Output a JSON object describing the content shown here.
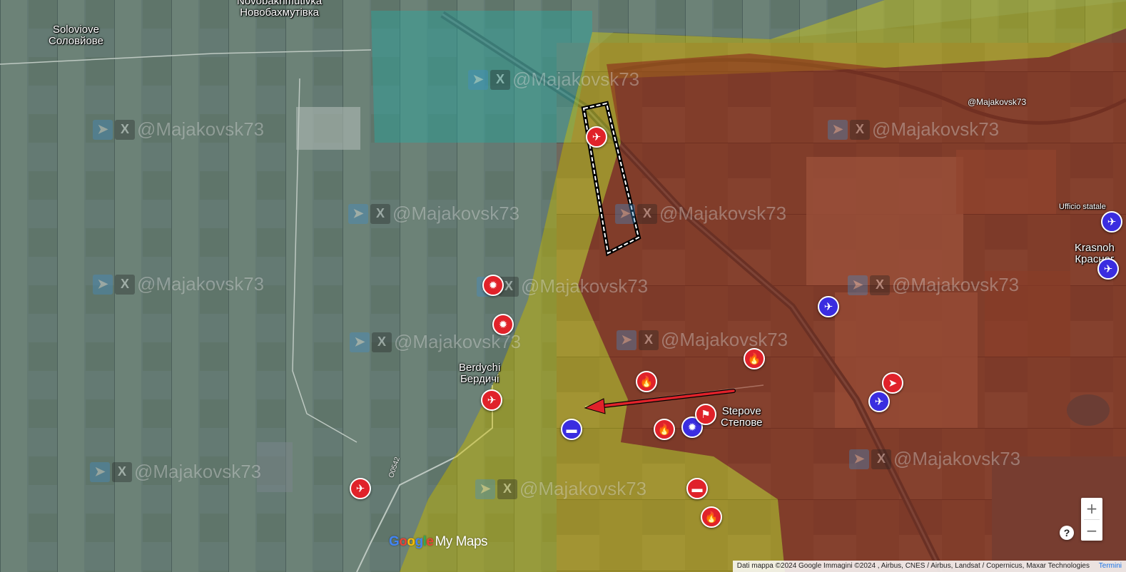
{
  "places": {
    "soloviove": {
      "latin": "Soloviove",
      "cyrillic": "Соловйове"
    },
    "novobakhmutivka": {
      "latin": "Novobakhmutivka",
      "cyrillic": "Новобахмутівка"
    },
    "berdychi": {
      "latin": "Berdychi",
      "cyrillic": "Бердичі"
    },
    "stepove": {
      "latin": "Stepove",
      "cyrillic": "Степове"
    },
    "krasnohorivka": {
      "latin": "Krasnoh",
      "cyrillic": "Красног"
    },
    "ufficio_statale": "Ufficio statale"
  },
  "watermark": {
    "handle": "@Majakovsk73",
    "telegram_icon": "telegram-icon",
    "x_icon": "x-icon",
    "x_glyph": "X",
    "tg_glyph": "➤"
  },
  "corner_handle": "@Majakovsk73",
  "road_label": "O0542",
  "markers": [
    {
      "id": "drone-red",
      "color": "red",
      "icon": "drone-icon",
      "glyph": "✈"
    },
    {
      "id": "explosion-red-1",
      "color": "red",
      "icon": "explosion-icon",
      "glyph": "✹"
    },
    {
      "id": "explosion-red-2",
      "color": "red",
      "icon": "explosion-icon",
      "glyph": "✹"
    },
    {
      "id": "aircraft-red-berdychi",
      "color": "red",
      "icon": "aircraft-icon",
      "glyph": "✈"
    },
    {
      "id": "aircraft-red-south",
      "color": "red",
      "icon": "aircraft-icon",
      "glyph": "✈"
    },
    {
      "id": "tank-blue-berdychi",
      "color": "blue",
      "icon": "tank-icon",
      "glyph": "▬"
    },
    {
      "id": "burning-tank-red-1",
      "color": "red",
      "icon": "burning-tank-icon",
      "glyph": "🔥"
    },
    {
      "id": "burning-tank-red-2",
      "color": "red",
      "icon": "burning-tank-icon",
      "glyph": "🔥"
    },
    {
      "id": "burning-tank-red-3",
      "color": "red",
      "icon": "burning-tank-icon",
      "glyph": "🔥"
    },
    {
      "id": "explosion-blue-stepove",
      "color": "blue",
      "icon": "explosion-icon",
      "glyph": "✹"
    },
    {
      "id": "flag-red-stepove",
      "color": "red",
      "icon": "flag-icon",
      "glyph": "⚑"
    },
    {
      "id": "tank-red-south",
      "color": "red",
      "icon": "tank-icon",
      "glyph": "▬"
    },
    {
      "id": "burning-tank-red-south",
      "color": "red",
      "icon": "burning-tank-icon",
      "glyph": "🔥"
    },
    {
      "id": "aircraft-blue-east",
      "color": "blue",
      "icon": "aircraft-icon",
      "glyph": "✈"
    },
    {
      "id": "infantry-red-east",
      "color": "red",
      "icon": "infantry-icon",
      "glyph": "➤"
    },
    {
      "id": "aircraft-blue-east-2",
      "color": "blue",
      "icon": "aircraft-icon",
      "glyph": "✈"
    },
    {
      "id": "aircraft-blue-krasnohorivka",
      "color": "blue",
      "icon": "aircraft-icon",
      "glyph": "✈"
    },
    {
      "id": "drone-blue-edge",
      "color": "blue",
      "icon": "drone-icon",
      "glyph": "✈"
    }
  ],
  "logo": {
    "g1": "G",
    "g2": "o",
    "g3": "o",
    "g4": "g",
    "g5": "l",
    "g6": "e",
    "product": "My Maps"
  },
  "attribution": {
    "text": "Dati mappa ©2024 Google Immagini ©2024 , Airbus, CNES / Airbus, Landsat / Copernicus, Maxar Technologies",
    "terms": "Termini"
  },
  "controls": {
    "zoom_in": "+",
    "zoom_out": "−",
    "help": "?"
  },
  "colors": {
    "russian_control": "#8a2a1a",
    "contested": "#c8c41a",
    "ukrainian_control": "#8cc8e8",
    "cyan_zone": "#2aa8a0",
    "marker_red": "#e0222a",
    "marker_blue": "#3a2de0"
  }
}
